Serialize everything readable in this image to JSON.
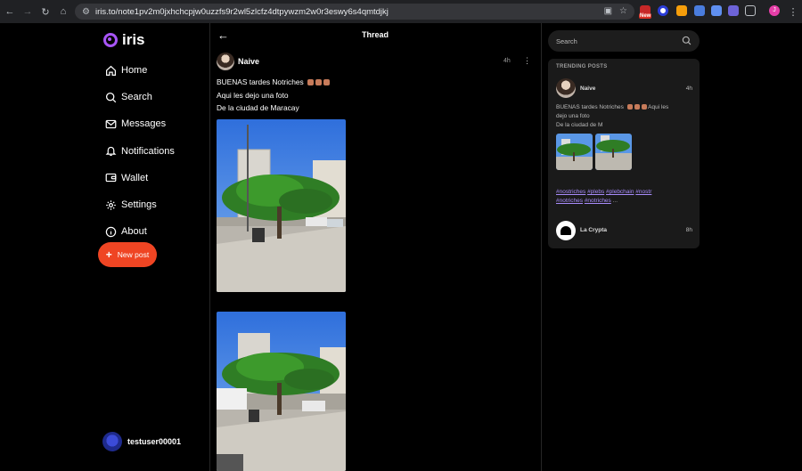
{
  "browser": {
    "url": "iris.to/note1pv2m0jxhchcpjw0uzzfs9r2wl5zlcfz4dtpywzm2w0r3eswy6s4qmtdjkj",
    "ext_badge": "New",
    "profile_initial": "J"
  },
  "app": {
    "name": "iris",
    "accent": "#a855f7",
    "cta_color": "#ef4523"
  },
  "menu": [
    {
      "label": "Home",
      "icon": "home-icon"
    },
    {
      "label": "Search",
      "icon": "search-icon"
    },
    {
      "label": "Messages",
      "icon": "mail-icon"
    },
    {
      "label": "Notifications",
      "icon": "bell-icon"
    },
    {
      "label": "Wallet",
      "icon": "wallet-icon"
    },
    {
      "label": "Settings",
      "icon": "gear-icon"
    },
    {
      "label": "About",
      "icon": "info-icon"
    }
  ],
  "new_post_label": "New post",
  "current_user": "testuser00001",
  "thread": {
    "title": "Thread",
    "post": {
      "author": "Naive",
      "time": "4h",
      "lines": [
        "BUENAS tardes Notriches",
        "Aqui les dejo una foto",
        "De la ciudad de Maracay"
      ]
    }
  },
  "right": {
    "search_placeholder": "Search",
    "trending_title": "TRENDING POSTS",
    "item1": {
      "author": "Naive",
      "time": "4h",
      "text_line1": "BUENAS tardes Notriches",
      "text_line1_tail": "Aqui les",
      "text_line2": "dejo una foto",
      "text_line3": "De la ciudad de M",
      "tags": [
        "#nostriches",
        "#plebs",
        "#plebchain",
        "#nostr",
        "#notriches",
        "#notriches"
      ],
      "ellipsis": "..."
    },
    "item2": {
      "author": "La Crypta",
      "time": "8h"
    }
  }
}
